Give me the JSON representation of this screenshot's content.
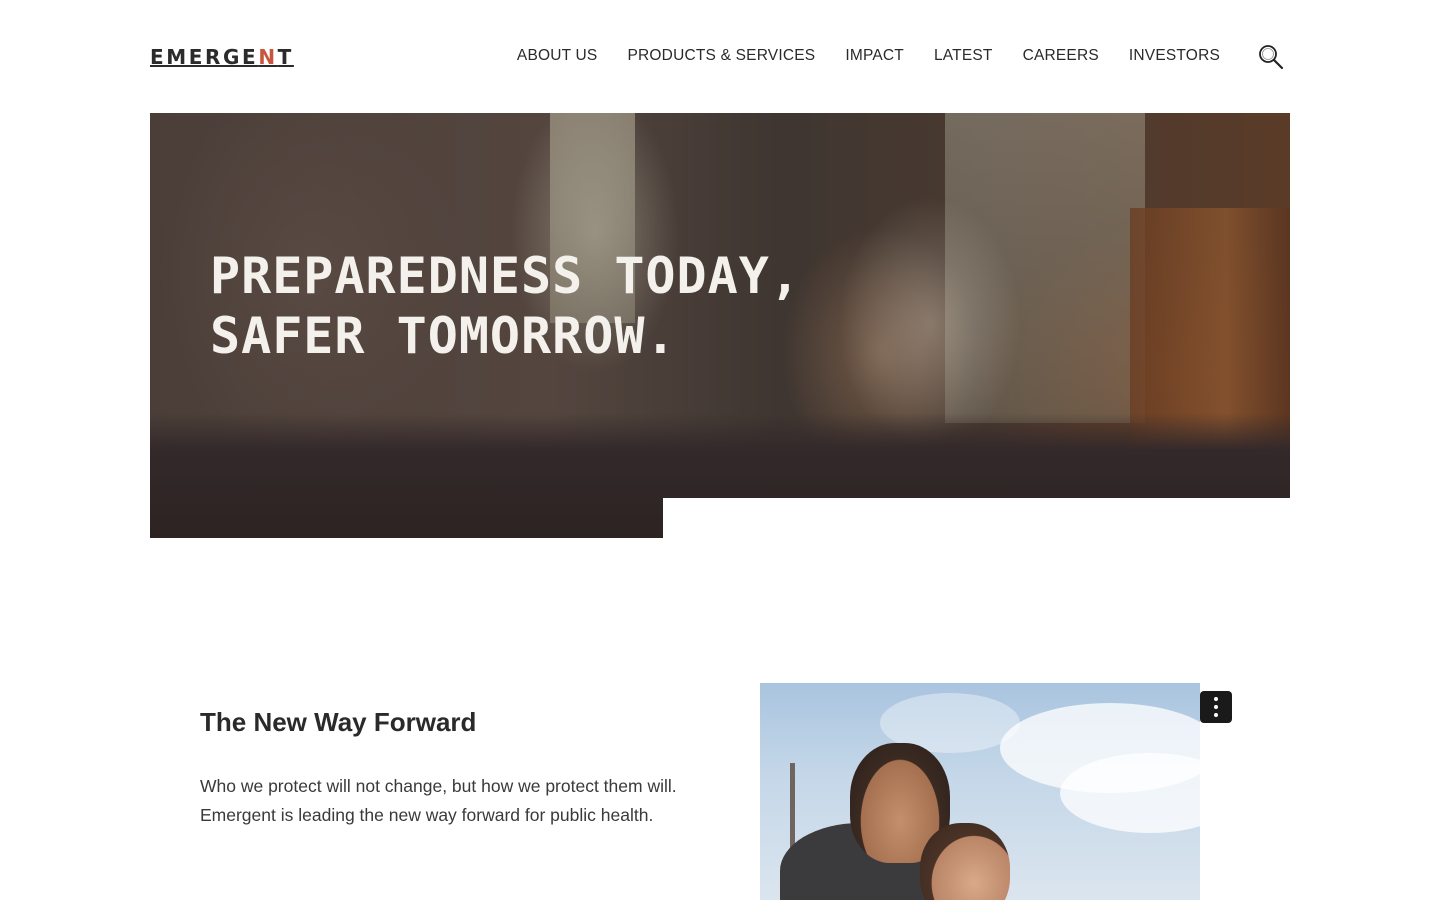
{
  "header": {
    "logo_text": "EMERGENT",
    "nav": [
      {
        "label": "ABOUT US"
      },
      {
        "label": "PRODUCTS & SERVICES"
      },
      {
        "label": "IMPACT"
      },
      {
        "label": "LATEST"
      },
      {
        "label": "CAREERS"
      },
      {
        "label": "INVESTORS"
      }
    ],
    "search_icon": "search-icon"
  },
  "hero": {
    "title": "PREPAREDNESS TODAY,\nSAFER TOMORROW."
  },
  "section": {
    "title": "The New Way Forward",
    "body": "Who we protect will not change, but how we protect them will. Emergent is leading the new way forward for public health."
  },
  "colors": {
    "logo_accent": "#c8553d",
    "text": "#2a2a2a",
    "menu_button": "#1a1a1a"
  }
}
